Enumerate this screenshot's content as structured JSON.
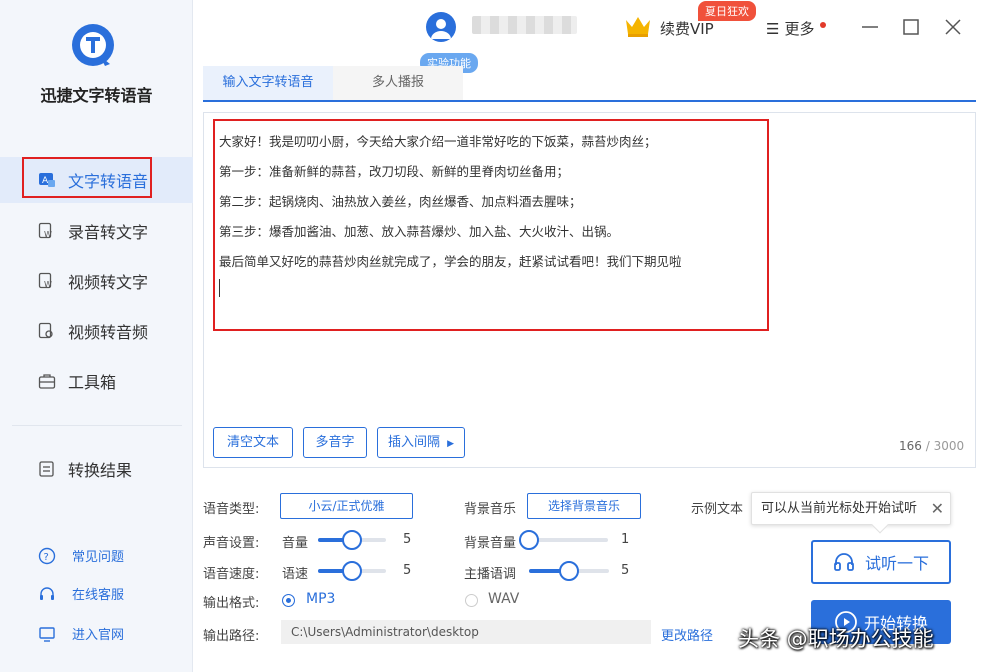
{
  "app": {
    "name": "迅捷文字转语音"
  },
  "sidebar": {
    "items": [
      {
        "label": "文字转语音",
        "icon": "text-to-speech-icon",
        "active": true
      },
      {
        "label": "录音转文字",
        "icon": "audio-to-text-icon"
      },
      {
        "label": "视频转文字",
        "icon": "video-to-text-icon"
      },
      {
        "label": "视频转音频",
        "icon": "video-to-audio-icon"
      },
      {
        "label": "工具箱",
        "icon": "toolbox-icon"
      }
    ],
    "result": {
      "label": "转换结果",
      "icon": "result-icon"
    },
    "footer": [
      {
        "label": "常见问题",
        "icon": "question-icon"
      },
      {
        "label": "在线客服",
        "icon": "headset-icon"
      },
      {
        "label": "进入官网",
        "icon": "monitor-icon"
      }
    ]
  },
  "topbar": {
    "experiment_badge": "实验功能",
    "vip_label": "续费VIP",
    "promo_badge": "夏日狂欢",
    "more_label": "更多"
  },
  "tabs": [
    {
      "label": "输入文字转语音",
      "active": true
    },
    {
      "label": "多人播报",
      "active": false
    }
  ],
  "editor": {
    "lines": [
      "大家好！我是叨叨小厨，今天给大家介绍一道非常好吃的下饭菜，蒜苔炒肉丝；",
      "第一步：准备新鲜的蒜苔，改刀切段、新鲜的里脊肉切丝备用；",
      "第二步：起锅烧肉、油热放入姜丝，肉丝爆香、加点料酒去腥味；",
      "第三步：爆香加酱油、加葱、放入蒜苔爆炒、加入盐、大火收汁、出锅。",
      "最后简单又好吃的蒜苔炒肉丝就完成了，学会的朋友，赶紧试试看吧！我们下期见啦"
    ],
    "buttons": {
      "clear": "清空文本",
      "polyphone": "多音字",
      "insert_pause": "插入间隔"
    },
    "char_count": "166",
    "char_max": "3000",
    "count_sep": "/"
  },
  "settings": {
    "voice_type": {
      "label": "语音类型:",
      "value": "小云/正式优雅"
    },
    "bg_music": {
      "label": "背景音乐",
      "button": "选择背景音乐"
    },
    "example_text": {
      "label": "示例文本"
    },
    "sound": {
      "label": "声音设置:",
      "sub": "音量",
      "value": 5,
      "max": 10
    },
    "bg_volume": {
      "label": "背景音量",
      "value": 1,
      "max": 10
    },
    "speed": {
      "label": "语音速度:",
      "sub": "语速",
      "value": 5,
      "max": 10
    },
    "pitch": {
      "label": "主播语调",
      "value": 5,
      "max": 10
    },
    "format": {
      "label": "输出格式:",
      "options": [
        "MP3",
        "WAV"
      ],
      "selected": "MP3"
    },
    "path": {
      "label": "输出路径:",
      "value": "C:\\Users\\Administrator\\desktop",
      "change": "更改路径"
    }
  },
  "tooltip": {
    "text": "可以从当前光标处开始试听"
  },
  "actions": {
    "listen": "试听一下",
    "start": "开始转换"
  },
  "watermark": "头条 @职场办公技能",
  "colors": {
    "accent": "#2a6fdb",
    "highlight": "#e02020",
    "promo": "#f0513b"
  }
}
